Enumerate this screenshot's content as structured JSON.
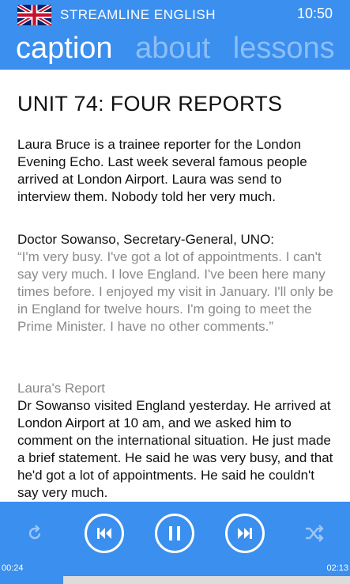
{
  "header": {
    "app_title": "STREAMLINE ENGLISH",
    "clock": "10:50",
    "flag_icon": "uk-flag-icon",
    "tabs": [
      {
        "label": "caption",
        "active": true
      },
      {
        "label": "about",
        "active": false
      },
      {
        "label": "lessons",
        "active": false
      }
    ]
  },
  "content": {
    "unit_title": "UNIT 74: FOUR REPORTS",
    "intro": "Laura Bruce is a trainee reporter for the London Evening Echo. Last week several famous people arrived at London Airport. Laura was send to interview them. Nobody told her very much.",
    "speaker": "Doctor Sowanso, Secretary-General, UNO:",
    "quote": "“I'm very busy. I've got a lot of appointments. I can't say very much. I love England. I've been here many times before. I enjoyed my visit in January. I'll only be in England for twelve hours. I'm going to meet the Prime Minister. I have no other comments.”",
    "report_heading": "Laura's Report",
    "report_text": "Dr Sowanso visited England yesterday. He arrived at London Airport at 10 am, and we asked him to comment on the international situation. He just made a brief statement. He said he was very busy, and that he'd got a lot of appointments. He said he couldn't say very much."
  },
  "player": {
    "elapsed": "00:24",
    "duration": "02:13",
    "progress_fraction": 0.18,
    "icons": [
      "repeat-icon",
      "previous-icon",
      "pause-icon",
      "next-icon",
      "shuffle-icon"
    ],
    "colors": {
      "accent": "#3a8fef",
      "track": "#dcdcdc"
    }
  }
}
